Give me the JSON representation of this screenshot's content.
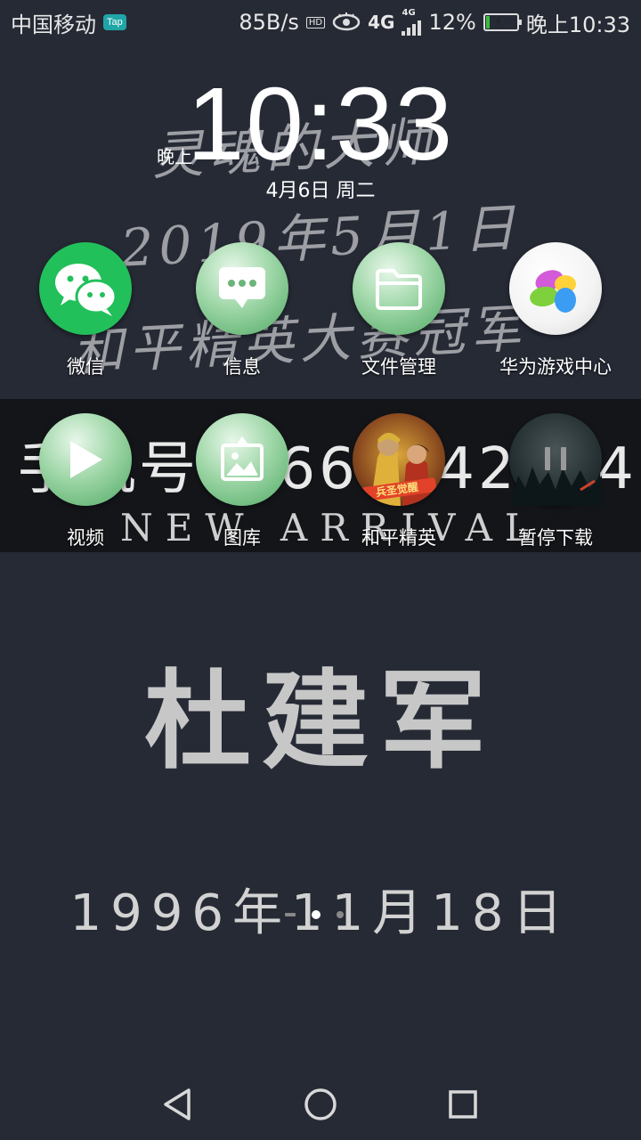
{
  "status_bar": {
    "carrier": "中国移动",
    "tap_badge": "Tap",
    "net_speed": "85B/s",
    "hd_label": "HD",
    "network_main": "4G",
    "network_sub": "4G",
    "battery_percent": "12%",
    "battery_level": 0.12,
    "time": "晚上10:33"
  },
  "wallpaper": {
    "handwriting_lines": [
      "灵魂的大师",
      "2019年5月1日",
      "和平精英大赛冠军"
    ],
    "band_text": "手机号18664442414",
    "band_subtext": "NEW ARRIVAL",
    "name": "杜建军",
    "birthday": "1996年11月18日"
  },
  "clock": {
    "time": "10:33",
    "ampm": "晚上",
    "date": "4月6日 周二"
  },
  "apps_row1": [
    {
      "label": "微信",
      "icon": "wechat-icon"
    },
    {
      "label": "信息",
      "icon": "messages-icon"
    },
    {
      "label": "文件管理",
      "icon": "folder-icon"
    },
    {
      "label": "华为游戏中心",
      "icon": "game-center-icon"
    }
  ],
  "apps_row2": [
    {
      "label": "视频",
      "icon": "play-icon"
    },
    {
      "label": "图库",
      "icon": "gallery-icon"
    },
    {
      "label": "和平精英",
      "icon": "game-character-icon"
    },
    {
      "label": "暂停下载",
      "icon": "pause-icon"
    }
  ],
  "nav": {
    "back_icon": "back-triangle-icon",
    "home_icon": "home-circle-icon",
    "recents_icon": "recents-square-icon"
  }
}
